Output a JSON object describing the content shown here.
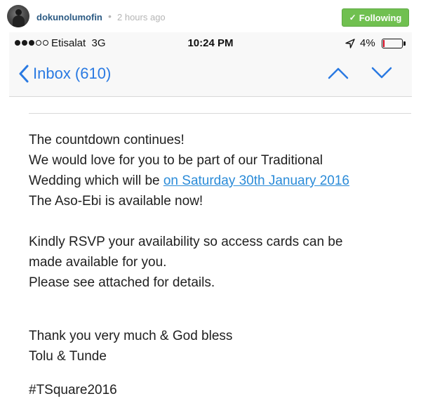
{
  "post": {
    "username": "dokunolumofin",
    "separator": "•",
    "time": "2 hours ago",
    "follow": {
      "check": "✓",
      "label": "Following",
      "color": "#70c050"
    }
  },
  "status_bar": {
    "carrier": "Etisalat",
    "network": "3G",
    "time": "10:24 PM",
    "battery_label": "4%",
    "battery_level": 0.04,
    "battery_color": "#d0021b"
  },
  "nav": {
    "back_label": "Inbox (610)",
    "accent": "#2a7ae2",
    "icons": [
      "chevron-left-icon",
      "chevron-up-icon",
      "chevron-down-icon"
    ]
  },
  "message": {
    "line1": "The countdown continues!",
    "line2": "We would love for you to be part of our Traditional",
    "line3_prefix": "Wedding which will be ",
    "line3_link": "on Saturday 30th January 2016",
    "line4": "The Aso-Ebi is available now!",
    "line5": "Kindly RSVP your availability so access cards can be",
    "line6": "made available for you.",
    "line7": "Please see attached for details.",
    "line8": "Thank you very much & God bless",
    "line9": "Tolu & Tunde",
    "line10": "#TSquare2016",
    "link_color": "#2a8bd8"
  }
}
